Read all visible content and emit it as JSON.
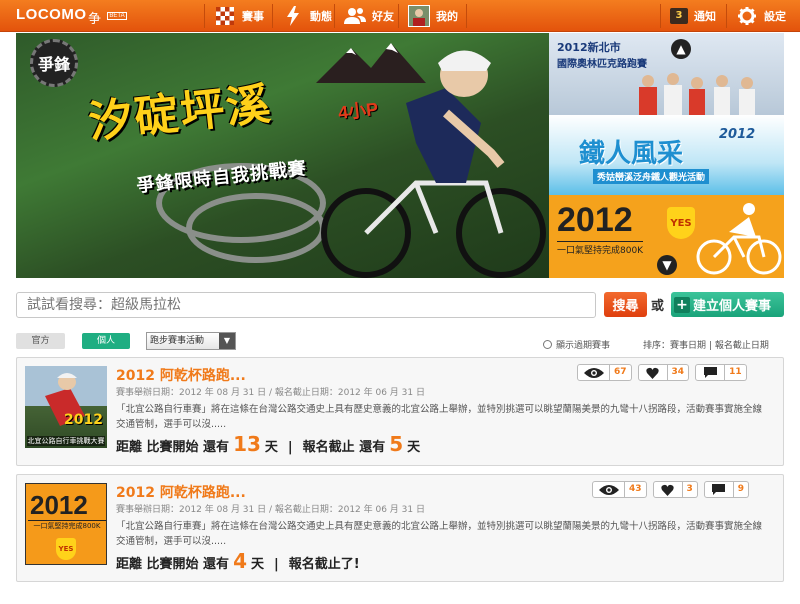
{
  "header": {
    "logo_text": "LOCOMO",
    "logo_mark": "争",
    "logo_badge": "BETA",
    "nav": [
      {
        "label": "賽事",
        "icon": "checkered-flag-icon"
      },
      {
        "label": "動態",
        "icon": "lightning-icon"
      },
      {
        "label": "好友",
        "icon": "friends-icon"
      },
      {
        "label": "我的",
        "icon": "user-avatar-icon"
      }
    ],
    "notifications": {
      "count": "3",
      "label": "通知"
    },
    "settings_label": "設定"
  },
  "banner": {
    "badge_text": "爭鋒",
    "title": "汐碇坪溪",
    "hours": "4小P",
    "subtitle": "爭鋒限時自我挑戰賽",
    "side": [
      {
        "title": "2012新北市",
        "subtitle": "國際奧林匹克路跑賽"
      },
      {
        "title": "鐵人風采",
        "year": "2012",
        "subtitle": "秀姑巒溪泛舟鐵人觀光活動"
      },
      {
        "title": "2012",
        "subtitle": "一口氣堅持完成800K",
        "badge": "YES"
      }
    ]
  },
  "search": {
    "placeholder": "試試看搜尋：超級馬拉松",
    "search_button": "搜尋",
    "or_text": "或",
    "create_button": "建立個人賽事"
  },
  "filters": {
    "tab_official": "官方",
    "tab_personal": "個人",
    "select_value": "跑步賽事活動",
    "radio_label": "顯示過期賽事",
    "sort_label": "排序：",
    "sort_event_date": "賽事日期",
    "sort_separator": "|",
    "sort_deadline": "報名截止日期"
  },
  "events": [
    {
      "title": "2012 阿乾杯路跑...",
      "dates": "賽事舉辦日期：2012 年 08 月 31 日 / 報名截止日期：2012 年 06 月 31 日",
      "description": "「北宜公路自行車賽」將在這條在台灣公路交通史上具有歷史意義的北宜公路上舉辦，並特別挑選可以眺望蘭陽美景的九彎十八拐路段，活動賽事實施全線交通管制，選手可以沒.....",
      "views": "67",
      "likes": "34",
      "comments": "11",
      "countdown_prefix": "距離 比賽開始 還有",
      "days_to_start": "13",
      "day_unit": "天",
      "separator": "|",
      "deadline_text": "報名截止 還有",
      "days_to_deadline": "5",
      "deadline_unit": "天",
      "thumb_year": "2012",
      "thumb_caption": "北宜公路自行車挑戰大賽"
    },
    {
      "title": "2012 阿乾杯路跑...",
      "dates": "賽事舉辦日期：2012 年 08 月 31 日 / 報名截止日期：2012 年 06 月 31 日",
      "description": "「北宜公路自行車賽」將在這條在台灣公路交通史上具有歷史意義的北宜公路上舉辦，並特別挑選可以眺望蘭陽美景的九彎十八拐路段，活動賽事實施全線交通管制，選手可以沒.....",
      "views": "43",
      "likes": "3",
      "comments": "9",
      "countdown_prefix": "距離 比賽開始 還有",
      "days_to_start": "4",
      "day_unit": "天",
      "separator": "|",
      "deadline_text": "報名截止了!",
      "thumb_year": "2012",
      "thumb_sub": "一口氣堅持完成800K",
      "thumb_badge": "YES"
    }
  ]
}
